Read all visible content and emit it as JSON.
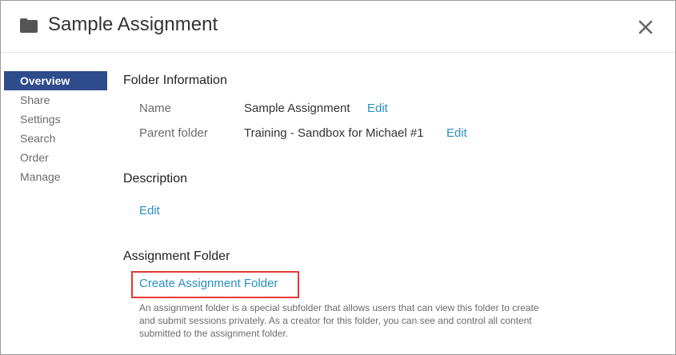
{
  "header": {
    "title": "Sample Assignment",
    "icon": "folder-icon",
    "close_icon": "close-icon"
  },
  "sidebar": {
    "items": [
      {
        "label": "Overview",
        "active": true
      },
      {
        "label": "Share",
        "active": false
      },
      {
        "label": "Settings",
        "active": false
      },
      {
        "label": "Search",
        "active": false
      },
      {
        "label": "Order",
        "active": false
      },
      {
        "label": "Manage",
        "active": false
      }
    ]
  },
  "folder_info": {
    "title": "Folder Information",
    "name_label": "Name",
    "name_value": "Sample Assignment",
    "name_edit": "Edit",
    "parent_label": "Parent folder",
    "parent_value": "Training - Sandbox for Michael #1",
    "parent_edit": "Edit"
  },
  "description": {
    "title": "Description",
    "edit": "Edit"
  },
  "assignment_folder": {
    "title": "Assignment Folder",
    "create_label": "Create Assignment Folder",
    "help_text": "An assignment folder is a special subfolder that allows users that can view this folder to create and submit sessions privately. As a creator for this folder, you can see and control all content submitted to the assignment folder."
  },
  "colors": {
    "accent": "#2e4b8c",
    "link": "#2a8fc1",
    "highlight": "#e53935"
  }
}
